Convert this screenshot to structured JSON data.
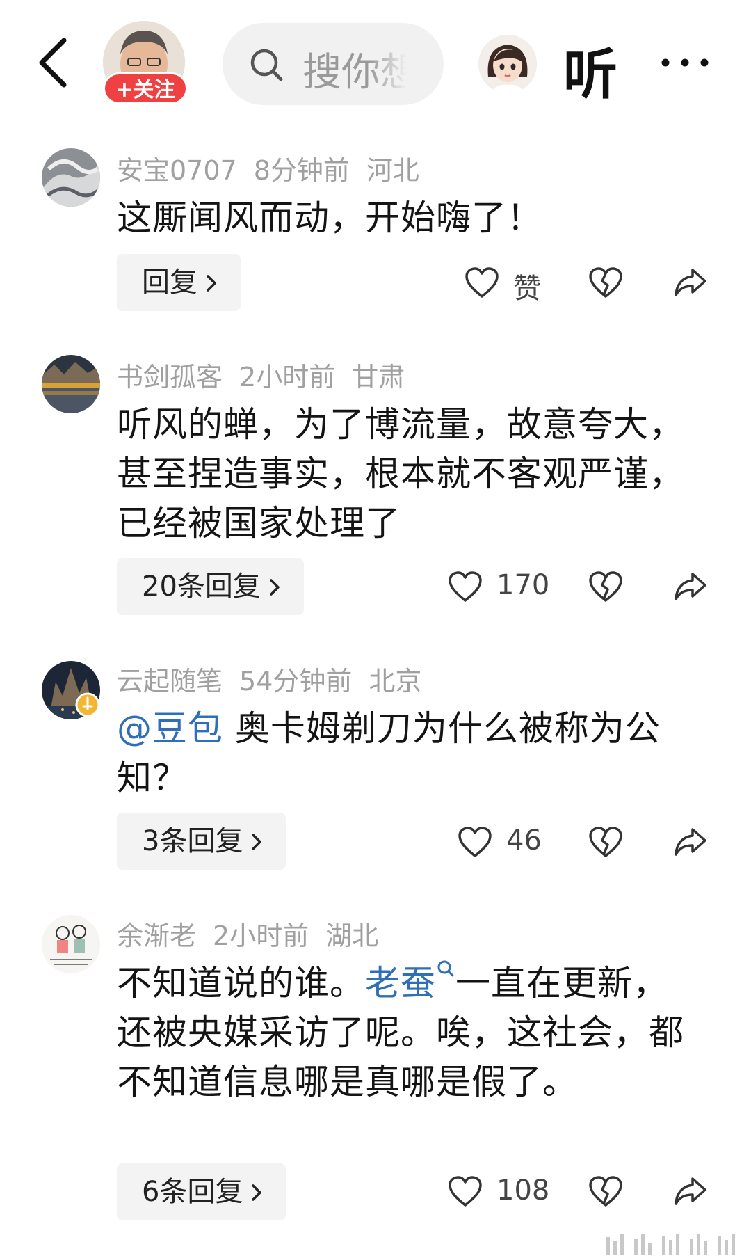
{
  "header": {
    "follow_label": "+关注",
    "search_placeholder": "搜你想",
    "listen_label": "听"
  },
  "comments": [
    {
      "username": "安宝0707",
      "time": "8分钟前",
      "location": "河北",
      "text": "这厮闻风而动，开始嗨了！",
      "reply_label": "回复",
      "likes": "赞"
    },
    {
      "username": "书剑孤客",
      "time": "2小时前",
      "location": "甘肃",
      "text": "听风的蝉，为了博流量，故意夸大，甚至捏造事实，根本就不客观严谨，已经被国家处理了",
      "reply_label": "20条回复",
      "likes": "170"
    },
    {
      "username": "云起随笔",
      "time": "54分钟前",
      "location": "北京",
      "mention": "@豆包",
      "text": " 奥卡姆剃刀为什么被称为公知？",
      "reply_label": "3条回复",
      "likes": "46"
    },
    {
      "username": "余渐老",
      "time": "2小时前",
      "location": "湖北",
      "text_before": "不知道说的谁。",
      "link": "老蚕",
      "text_after": "一直在更新，还被央媒采访了呢。唉，这社会，都不知道信息哪是真哪是假了。",
      "reply_label": "6条回复",
      "likes": "108"
    }
  ],
  "colors": {
    "follow_bg": "#f04142",
    "mention": "#2f6fb8",
    "meta": "#a0a0a0"
  }
}
